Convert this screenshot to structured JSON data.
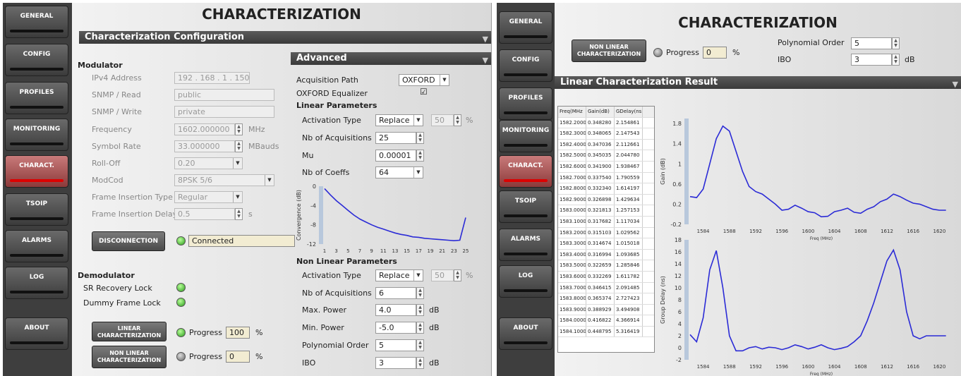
{
  "nav": [
    "GENERAL",
    "CONFIG",
    "PROFILES",
    "MONITORING",
    "CHARACT.",
    "TSOIP",
    "ALARMS",
    "LOG",
    "ABOUT"
  ],
  "title": "CHARACTERIZATION",
  "config_section": "Characterization Configuration",
  "modulator": {
    "heading": "Modulator",
    "ipv4_label": "IPv4 Address",
    "ipv4": "192 . 168 . 1    . 150",
    "snmp_read_label": "SNMP / Read",
    "snmp_read": "public",
    "snmp_write_label": "SNMP / Write",
    "snmp_write": "private",
    "freq_label": "Frequency",
    "freq": "1602.000000",
    "freq_unit": "MHz",
    "sr_label": "Symbol Rate",
    "sr": "33.000000",
    "sr_unit": "MBauds",
    "rolloff_label": "Roll-Off",
    "rolloff": "0.20",
    "modcod_label": "ModCod",
    "modcod": "8PSK 5/6",
    "fit_label": "Frame Insertion Type",
    "fit": "Regular",
    "fid_label": "Frame Insertion Delay",
    "fid": "0.5",
    "fid_unit": "s",
    "disconnect": "DISCONNECTION",
    "status": "Connected"
  },
  "demodulator": {
    "heading": "Demodulator",
    "sr_lock": "SR Recovery Lock",
    "dummy_lock": "Dummy Frame Lock"
  },
  "char_buttons": {
    "linear": "LINEAR CHARACTERIZATION",
    "nonlinear": "NON LINEAR CHARACTERIZATION",
    "progress_label": "Progress",
    "linear_progress": "100",
    "nonlinear_progress": "0",
    "pct": "%"
  },
  "advanced": {
    "heading": "Advanced",
    "acq_path_label": "Acquisition Path",
    "acq_path": "OXFORD",
    "oxford_eq_label": "OXFORD Equalizer",
    "oxford_eq": "☑",
    "linear_heading": "Linear Parameters",
    "act_type_label": "Activation Type",
    "act_type": "Replace",
    "act_pct": "50",
    "pct": "%",
    "nb_acq_label": "Nb of Acquisitions",
    "nb_acq": "25",
    "mu_label": "Mu",
    "mu": "0.00001",
    "nb_coeffs_label": "Nb of Coeffs",
    "nb_coeffs": "64",
    "nonlinear_heading": "Non Linear Parameters",
    "nl_act_type": "Replace",
    "nl_act_pct": "50",
    "nl_nb_acq": "6",
    "max_power_label": "Max. Power",
    "max_power": "4.0",
    "db": "dB",
    "min_power_label": "Min. Power",
    "min_power": "-5.0",
    "poly_label": "Polynomial Order",
    "poly": "5",
    "ibo_label": "IBO",
    "ibo": "3"
  },
  "right": {
    "nonlinear_btn": "NON LINEAR CHARACTERIZATION",
    "progress_label": "Progress",
    "progress": "0",
    "pct": "%",
    "poly_label": "Polynomial Order",
    "poly": "5",
    "ibo_label": "IBO",
    "ibo": "3",
    "db": "dB",
    "result_section": "Linear Characterization Result",
    "table_headers": [
      "Freq(MHz",
      "Gain(dB)",
      "GDelay(ns)"
    ],
    "table_rows": [
      [
        "1582.2000",
        "0.348280",
        "2.154861"
      ],
      [
        "1582.3000",
        "0.348065",
        "2.147543"
      ],
      [
        "1582.4000",
        "0.347036",
        "2.112661"
      ],
      [
        "1582.5000",
        "0.345035",
        "2.044780"
      ],
      [
        "1582.6000",
        "0.341900",
        "1.938467"
      ],
      [
        "1582.7000",
        "0.337540",
        "1.790559"
      ],
      [
        "1582.8000",
        "0.332340",
        "1.614197"
      ],
      [
        "1582.9000",
        "0.326898",
        "1.429634"
      ],
      [
        "1583.0000",
        "0.321813",
        "1.257153"
      ],
      [
        "1583.1000",
        "0.317682",
        "1.117034"
      ],
      [
        "1583.2000",
        "0.315103",
        "1.029562"
      ],
      [
        "1583.3000",
        "0.314674",
        "1.015018"
      ],
      [
        "1583.4000",
        "0.316994",
        "1.093685"
      ],
      [
        "1583.5000",
        "0.322659",
        "1.285846"
      ],
      [
        "1583.6000",
        "0.332269",
        "1.611782"
      ],
      [
        "1583.7000",
        "0.346415",
        "2.091485"
      ],
      [
        "1583.8000",
        "0.365374",
        "2.727423"
      ],
      [
        "1583.9000",
        "0.388929",
        "3.494908"
      ],
      [
        "1584.0000",
        "0.416822",
        "4.366914"
      ],
      [
        "1584.1000",
        "0.448795",
        "5.316419"
      ]
    ]
  },
  "chart_data": [
    {
      "type": "line",
      "xlabel": "",
      "ylabel": "Convergence (dB)",
      "ylim": [
        -12,
        0
      ],
      "x": [
        1,
        2,
        3,
        4,
        5,
        6,
        7,
        8,
        9,
        10,
        11,
        12,
        13,
        14,
        15,
        16,
        17,
        18,
        19,
        20,
        21,
        22,
        23,
        24,
        25
      ],
      "series": [
        {
          "values": [
            -0.5,
            -1.8,
            -3.0,
            -4.0,
            -5.0,
            -6.0,
            -6.8,
            -7.4,
            -8.0,
            -8.5,
            -8.9,
            -9.3,
            -9.7,
            -10.0,
            -10.2,
            -10.5,
            -10.6,
            -10.8,
            -10.9,
            -11.0,
            -11.1,
            -11.2,
            -11.3,
            -11.2,
            -6.5
          ]
        }
      ],
      "xticks": [
        1,
        3,
        5,
        7,
        9,
        11,
        13,
        15,
        17,
        19,
        21,
        23,
        25
      ],
      "yticks": [
        0,
        -4,
        -8,
        -12
      ]
    },
    {
      "type": "line",
      "xlabel": "Freq (MHz)",
      "ylabel": "Gain (dB)",
      "ylim": [
        -0.2,
        1.9
      ],
      "xlim": [
        1582,
        1622
      ],
      "x": [
        1582,
        1583,
        1584,
        1585,
        1586,
        1587,
        1588,
        1589,
        1590,
        1591,
        1592,
        1593,
        1594,
        1595,
        1596,
        1597,
        1598,
        1599,
        1600,
        1601,
        1602,
        1603,
        1604,
        1605,
        1606,
        1607,
        1608,
        1609,
        1610,
        1611,
        1612,
        1613,
        1614,
        1615,
        1616,
        1617,
        1618,
        1619,
        1620,
        1621
      ],
      "series": [
        {
          "values": [
            0.35,
            0.33,
            0.5,
            1.0,
            1.5,
            1.75,
            1.65,
            1.25,
            0.85,
            0.55,
            0.45,
            0.4,
            0.3,
            0.2,
            0.08,
            0.1,
            0.18,
            0.12,
            0.05,
            0.03,
            -0.05,
            -0.04,
            0.05,
            0.08,
            0.12,
            0.04,
            0.02,
            0.1,
            0.15,
            0.25,
            0.3,
            0.4,
            0.35,
            0.28,
            0.22,
            0.2,
            0.15,
            0.1,
            0.08,
            0.08
          ]
        }
      ],
      "xticks": [
        1584,
        1588,
        1592,
        1596,
        1600,
        1604,
        1608,
        1612,
        1616,
        1620
      ],
      "yticks": [
        1.8,
        1.4,
        1,
        0.6,
        0.2,
        -0.2
      ]
    },
    {
      "type": "line",
      "xlabel": "Freq (MHz)",
      "ylabel": "Group Delay (ns)",
      "ylim": [
        -2,
        18
      ],
      "xlim": [
        1582,
        1622
      ],
      "x": [
        1582,
        1583,
        1584,
        1585,
        1586,
        1587,
        1588,
        1589,
        1590,
        1591,
        1592,
        1593,
        1594,
        1595,
        1596,
        1597,
        1598,
        1599,
        1600,
        1601,
        1602,
        1603,
        1604,
        1605,
        1606,
        1607,
        1608,
        1609,
        1610,
        1611,
        1612,
        1613,
        1614,
        1615,
        1616,
        1617,
        1618,
        1619,
        1620,
        1621
      ],
      "series": [
        {
          "values": [
            2.2,
            1.0,
            5.0,
            13.0,
            16.2,
            10.0,
            2.0,
            -0.5,
            -0.5,
            0.0,
            0.2,
            -0.2,
            0.1,
            0.0,
            -0.3,
            0.0,
            0.5,
            0.2,
            -0.2,
            0.1,
            0.5,
            0.0,
            -0.3,
            -0.1,
            0.2,
            1.0,
            2.0,
            4.5,
            7.5,
            11.0,
            14.5,
            16.3,
            13.0,
            6.0,
            2.0,
            1.5,
            2.0,
            2.0,
            2.0,
            2.0
          ]
        }
      ],
      "xticks": [
        1584,
        1588,
        1592,
        1596,
        1600,
        1604,
        1608,
        1612,
        1616,
        1620
      ],
      "yticks": [
        18,
        16,
        14,
        12,
        10,
        8,
        6,
        4,
        2,
        0,
        -2
      ]
    }
  ],
  "colors": {
    "line": "#2b2bd6",
    "active_nav": "#a04545",
    "led_green": "#2a9a1a"
  }
}
